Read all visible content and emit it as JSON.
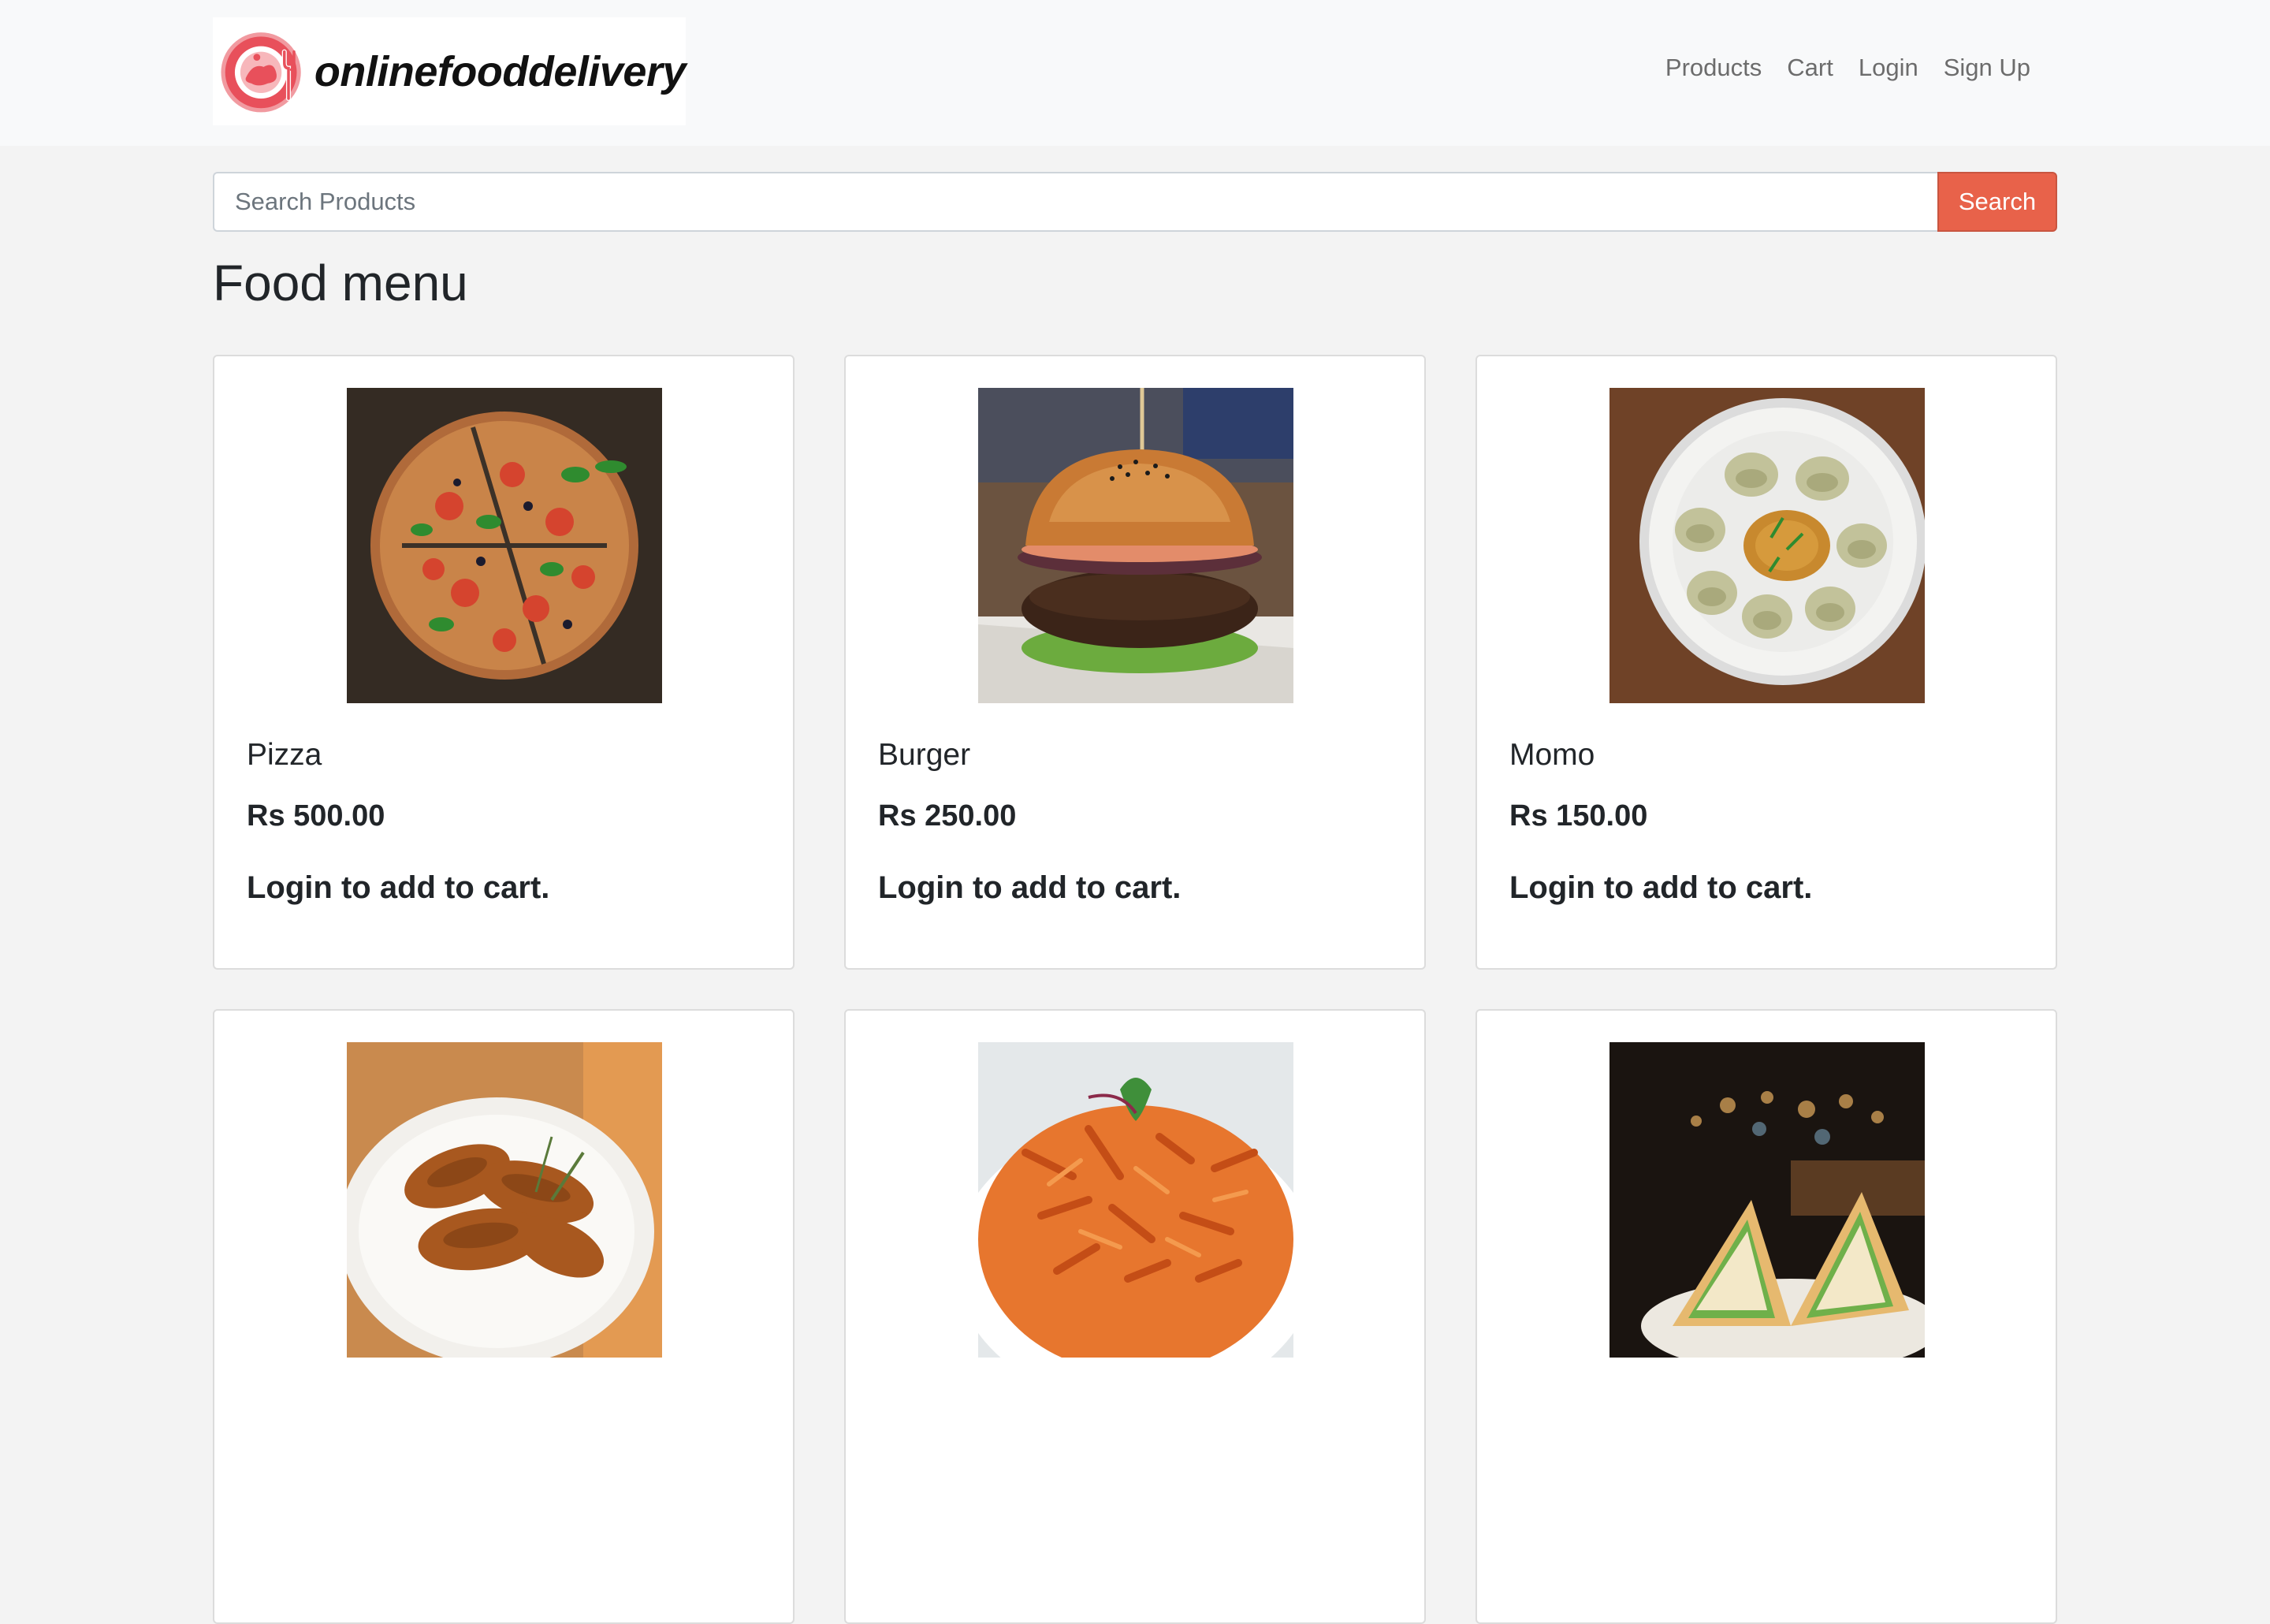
{
  "brand": {
    "name": "onlinefooddelivery",
    "accent_color": "#e8505b"
  },
  "nav": {
    "items": [
      {
        "label": "Products"
      },
      {
        "label": "Cart"
      },
      {
        "label": "Login"
      },
      {
        "label": "Sign Up"
      }
    ]
  },
  "search": {
    "placeholder": "Search Products",
    "button_label": "Search",
    "button_color": "#e8624a"
  },
  "page_title": "Food menu",
  "products": [
    {
      "name": "Pizza",
      "price": "Rs 500.00",
      "cta": "Login to add to cart.",
      "image": "pizza-photo"
    },
    {
      "name": "Burger",
      "price": "Rs 250.00",
      "cta": "Login to add to cart.",
      "image": "burger-photo"
    },
    {
      "name": "Momo",
      "price": "Rs 150.00",
      "cta": "Login to add to cart.",
      "image": "momo-photo"
    },
    {
      "name": "",
      "price": "",
      "cta": "",
      "image": "chicken-wings-photo"
    },
    {
      "name": "",
      "price": "",
      "cta": "",
      "image": "pasta-photo"
    },
    {
      "name": "",
      "price": "",
      "cta": "",
      "image": "sandwich-photo"
    }
  ]
}
